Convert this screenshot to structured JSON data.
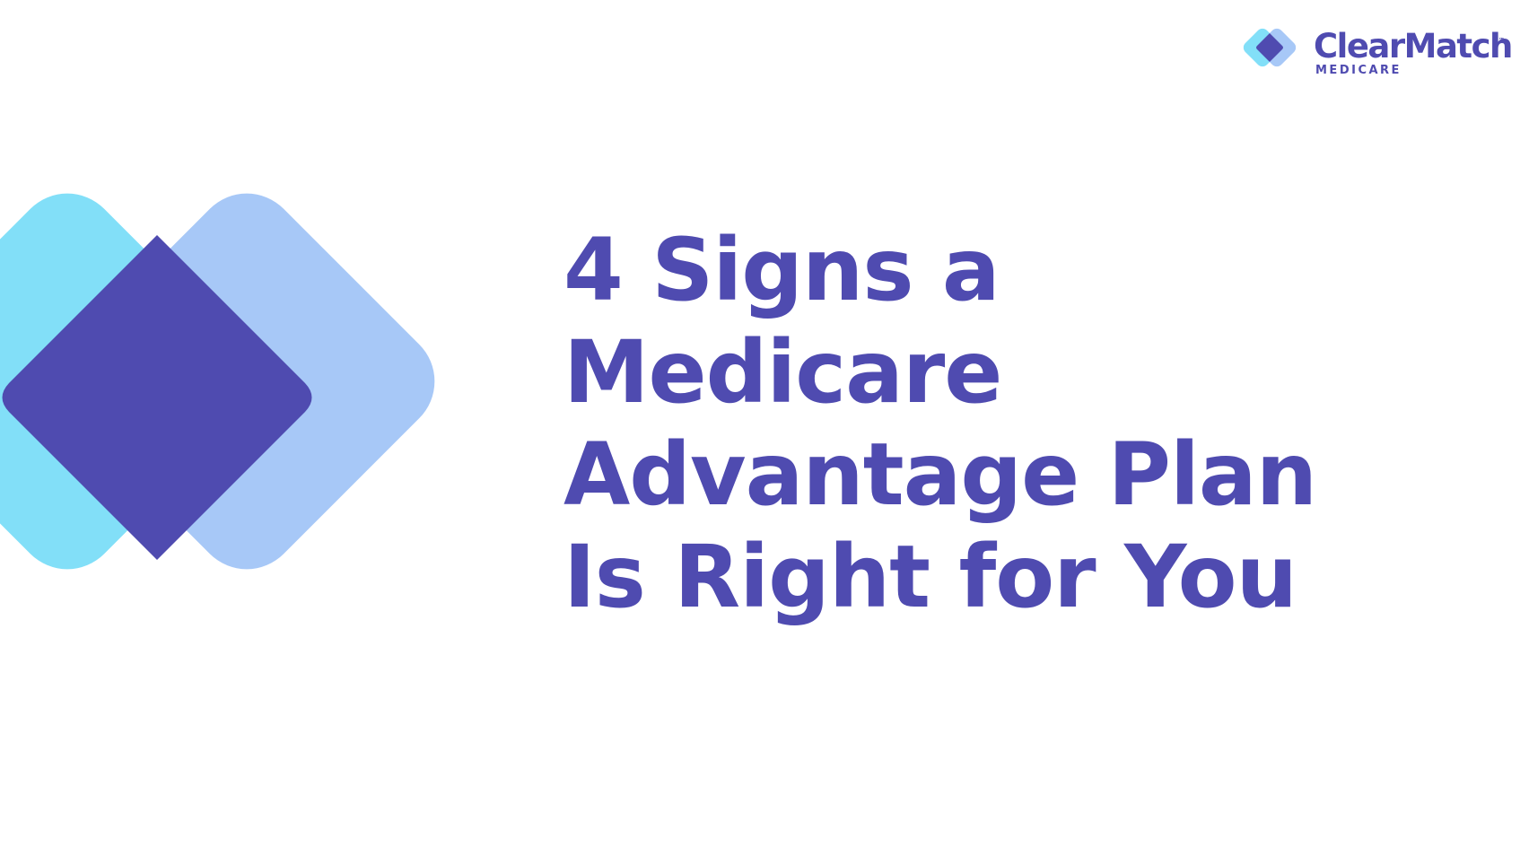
{
  "brand": {
    "name": "ClearMatch",
    "trademark": "™",
    "subtitle": "MEDICARE"
  },
  "headline": {
    "lines": [
      "4 Signs a",
      "Medicare",
      "Advantage Plan",
      "Is Right for You"
    ]
  },
  "colors": {
    "primary_purple": "#4F4BB0",
    "light_cyan": "#82DFF8",
    "light_blue": "#A7C8F7",
    "background": "#FFFFFF"
  },
  "icons": {
    "hero": "overlapping-diamonds-icon",
    "logo": "clearmatch-diamond-icon"
  }
}
